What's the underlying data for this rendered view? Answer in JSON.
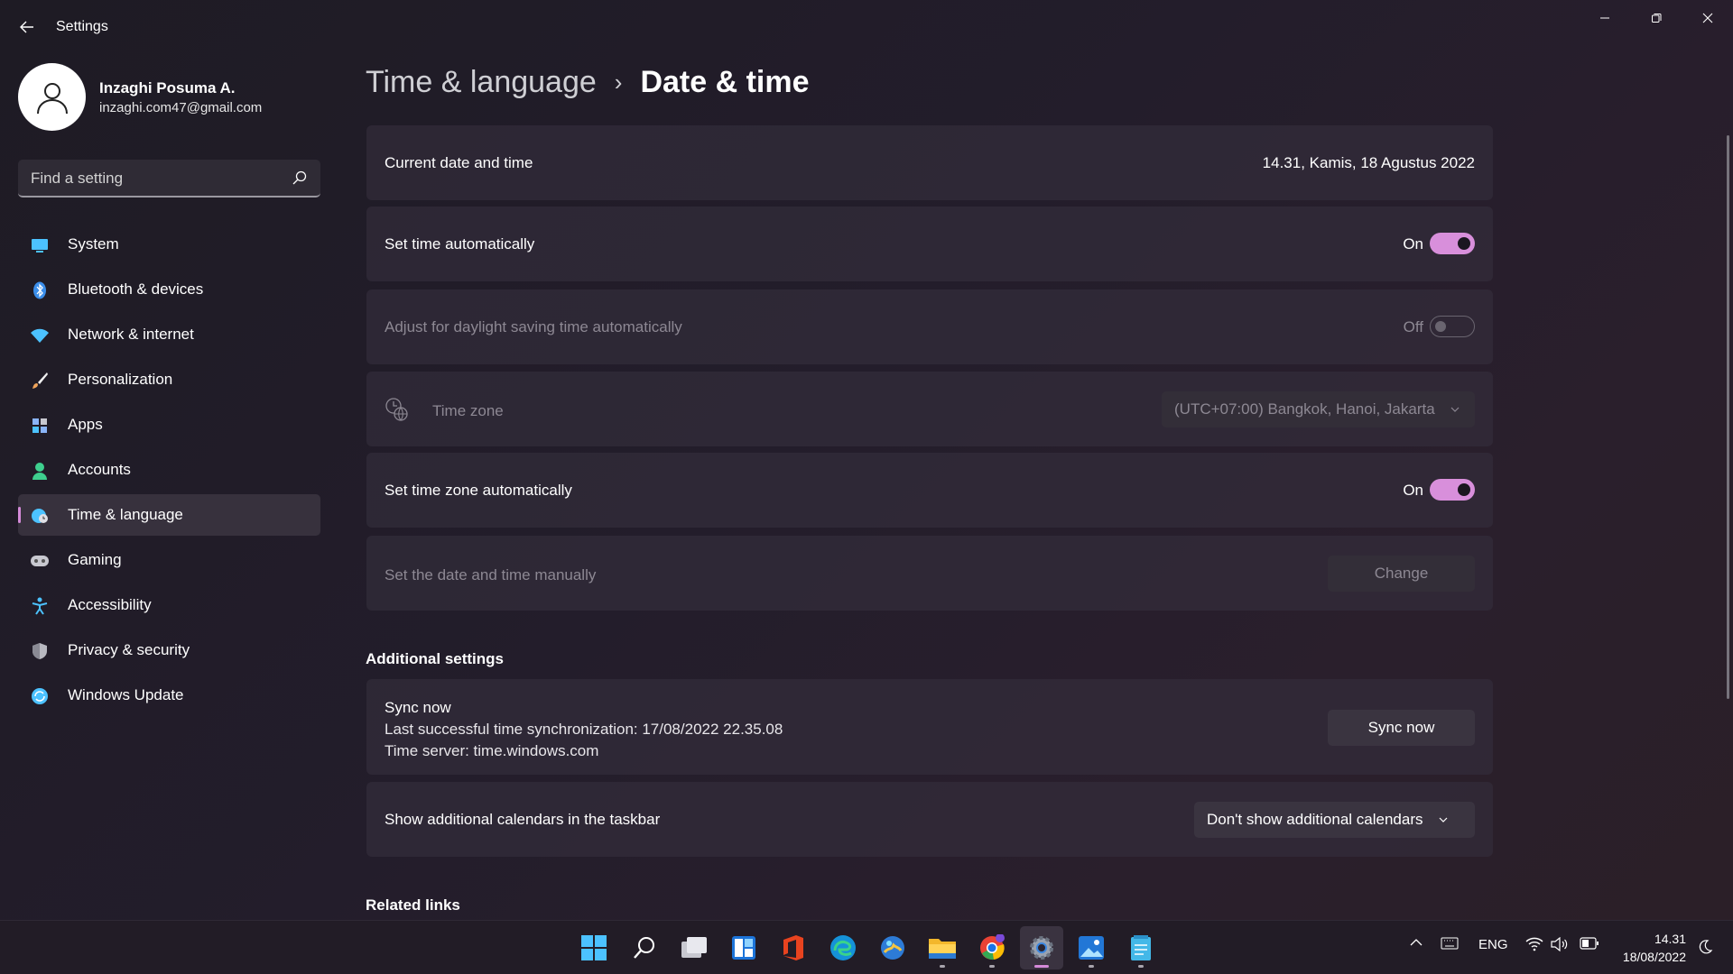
{
  "window": {
    "title": "Settings",
    "back_icon": "back-arrow-icon",
    "controls": [
      "minimize-icon",
      "maximize-icon",
      "close-icon"
    ]
  },
  "profile": {
    "name": "Inzaghi Posuma A.",
    "email": "inzaghi.com47@gmail.com"
  },
  "search": {
    "placeholder": "Find a setting",
    "value": ""
  },
  "sidebar": {
    "items": [
      {
        "label": "System",
        "icon": "monitor-icon",
        "color": "#4cc2ff"
      },
      {
        "label": "Bluetooth & devices",
        "icon": "bluetooth-icon",
        "color": "#3b8eea"
      },
      {
        "label": "Network & internet",
        "icon": "wifi-icon",
        "color": "#4cc2ff"
      },
      {
        "label": "Personalization",
        "icon": "brush-icon",
        "color": "#f0a45a"
      },
      {
        "label": "Apps",
        "icon": "apps-icon",
        "color": "#8ab4f8"
      },
      {
        "label": "Accounts",
        "icon": "person-icon",
        "color": "#3ecf8e"
      },
      {
        "label": "Time & language",
        "icon": "globe-clock-icon",
        "color": "#4cc2ff",
        "active": true
      },
      {
        "label": "Gaming",
        "icon": "gamepad-icon",
        "color": "#c8c8d0"
      },
      {
        "label": "Accessibility",
        "icon": "accessibility-icon",
        "color": "#4cc2ff"
      },
      {
        "label": "Privacy & security",
        "icon": "shield-icon",
        "color": "#b8b8c0"
      },
      {
        "label": "Windows Update",
        "icon": "update-icon",
        "color": "#4cc2ff"
      }
    ]
  },
  "breadcrumb": {
    "parent": "Time & language",
    "separator": "›",
    "current": "Date & time"
  },
  "settings": {
    "current_datetime": {
      "label": "Current date and time",
      "value": "14.31, Kamis, 18 Agustus 2022"
    },
    "set_time_auto": {
      "label": "Set time automatically",
      "state": "On"
    },
    "daylight": {
      "label": "Adjust for daylight saving time automatically",
      "state": "Off"
    },
    "timezone": {
      "label": "Time zone",
      "value": "(UTC+07:00) Bangkok, Hanoi, Jakarta"
    },
    "set_tz_auto": {
      "label": "Set time zone automatically",
      "state": "On"
    },
    "manual": {
      "label": "Set the date and time manually",
      "button": "Change"
    }
  },
  "additional": {
    "title": "Additional settings",
    "sync": {
      "title": "Sync now",
      "last_sync": "Last successful time synchronization: 17/08/2022 22.35.08",
      "server": "Time server: time.windows.com",
      "button": "Sync now"
    },
    "calendars": {
      "label": "Show additional calendars in the taskbar",
      "value": "Don't show additional calendars"
    }
  },
  "related": {
    "title": "Related links"
  },
  "taskbar": {
    "apps": [
      "windows-start-icon",
      "search-icon",
      "task-view-icon",
      "widgets-icon",
      "office-icon",
      "edge-icon",
      "photos-icon",
      "file-explorer-icon",
      "chrome-icon",
      "settings-icon",
      "photos-app-icon",
      "notepad-icon"
    ],
    "language": "ENG",
    "time": "14.31",
    "date": "18/08/2022"
  },
  "colors": {
    "accent": "#d88fdb",
    "background": "#231d2b",
    "card": "#342e3c"
  }
}
